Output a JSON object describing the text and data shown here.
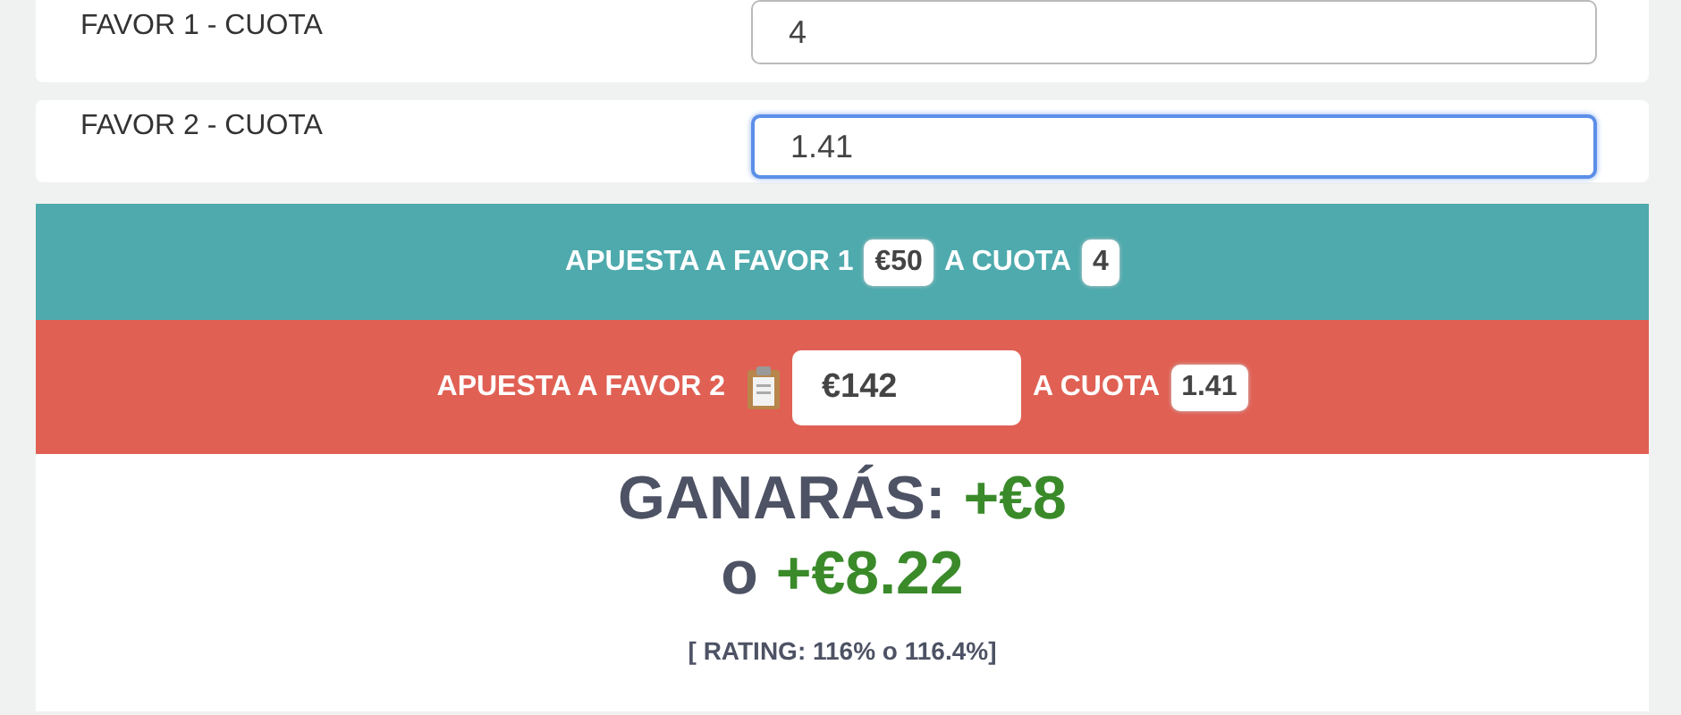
{
  "odds_fields": [
    {
      "label": "FAVOR 1 - CUOTA",
      "value": "4",
      "focused": false
    },
    {
      "label": "FAVOR 2 - CUOTA",
      "value": "1.41",
      "focused": true
    }
  ],
  "bets": [
    {
      "kind": "fixed",
      "label": "APUESTA A FAVOR 1",
      "stake": "€50",
      "odds_label": "A CUOTA",
      "odds": "4",
      "color": "#4eaaad"
    },
    {
      "kind": "editable",
      "label": "APUESTA A FAVOR 2",
      "stake": "€142",
      "odds_label": "A CUOTA",
      "odds": "1.41",
      "color": "#e06054"
    }
  ],
  "result": {
    "label": "GANARÁS:",
    "profit": "+€8",
    "connector": "o",
    "profit_exact": "+€8.22",
    "rating": "[ RATING: 116% o 116.4%]"
  }
}
